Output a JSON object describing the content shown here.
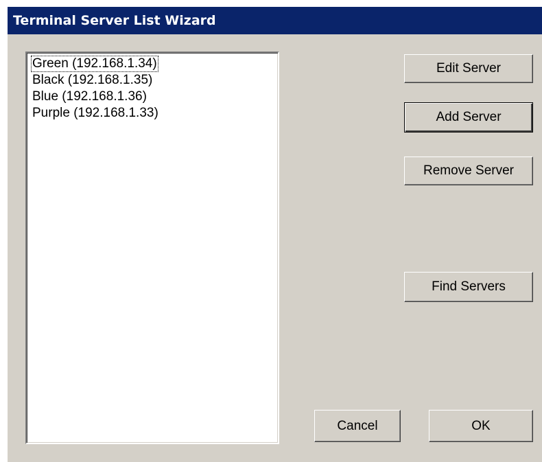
{
  "window": {
    "title": "Terminal Server List Wizard"
  },
  "server_list": {
    "items": [
      {
        "label": "Green (192.168.1.34)",
        "focused": true
      },
      {
        "label": "Black (192.168.1.35)",
        "focused": false
      },
      {
        "label": "Blue (192.168.1.36)",
        "focused": false
      },
      {
        "label": "Purple (192.168.1.33)",
        "focused": false
      }
    ]
  },
  "buttons": {
    "edit": "Edit Server",
    "add": "Add Server",
    "remove": "Remove Server",
    "find": "Find Servers",
    "cancel": "Cancel",
    "ok": "OK"
  },
  "colors": {
    "titlebar": "#0a246a",
    "dialog_face": "#d4d0c8",
    "title_text": "#ffffff"
  }
}
